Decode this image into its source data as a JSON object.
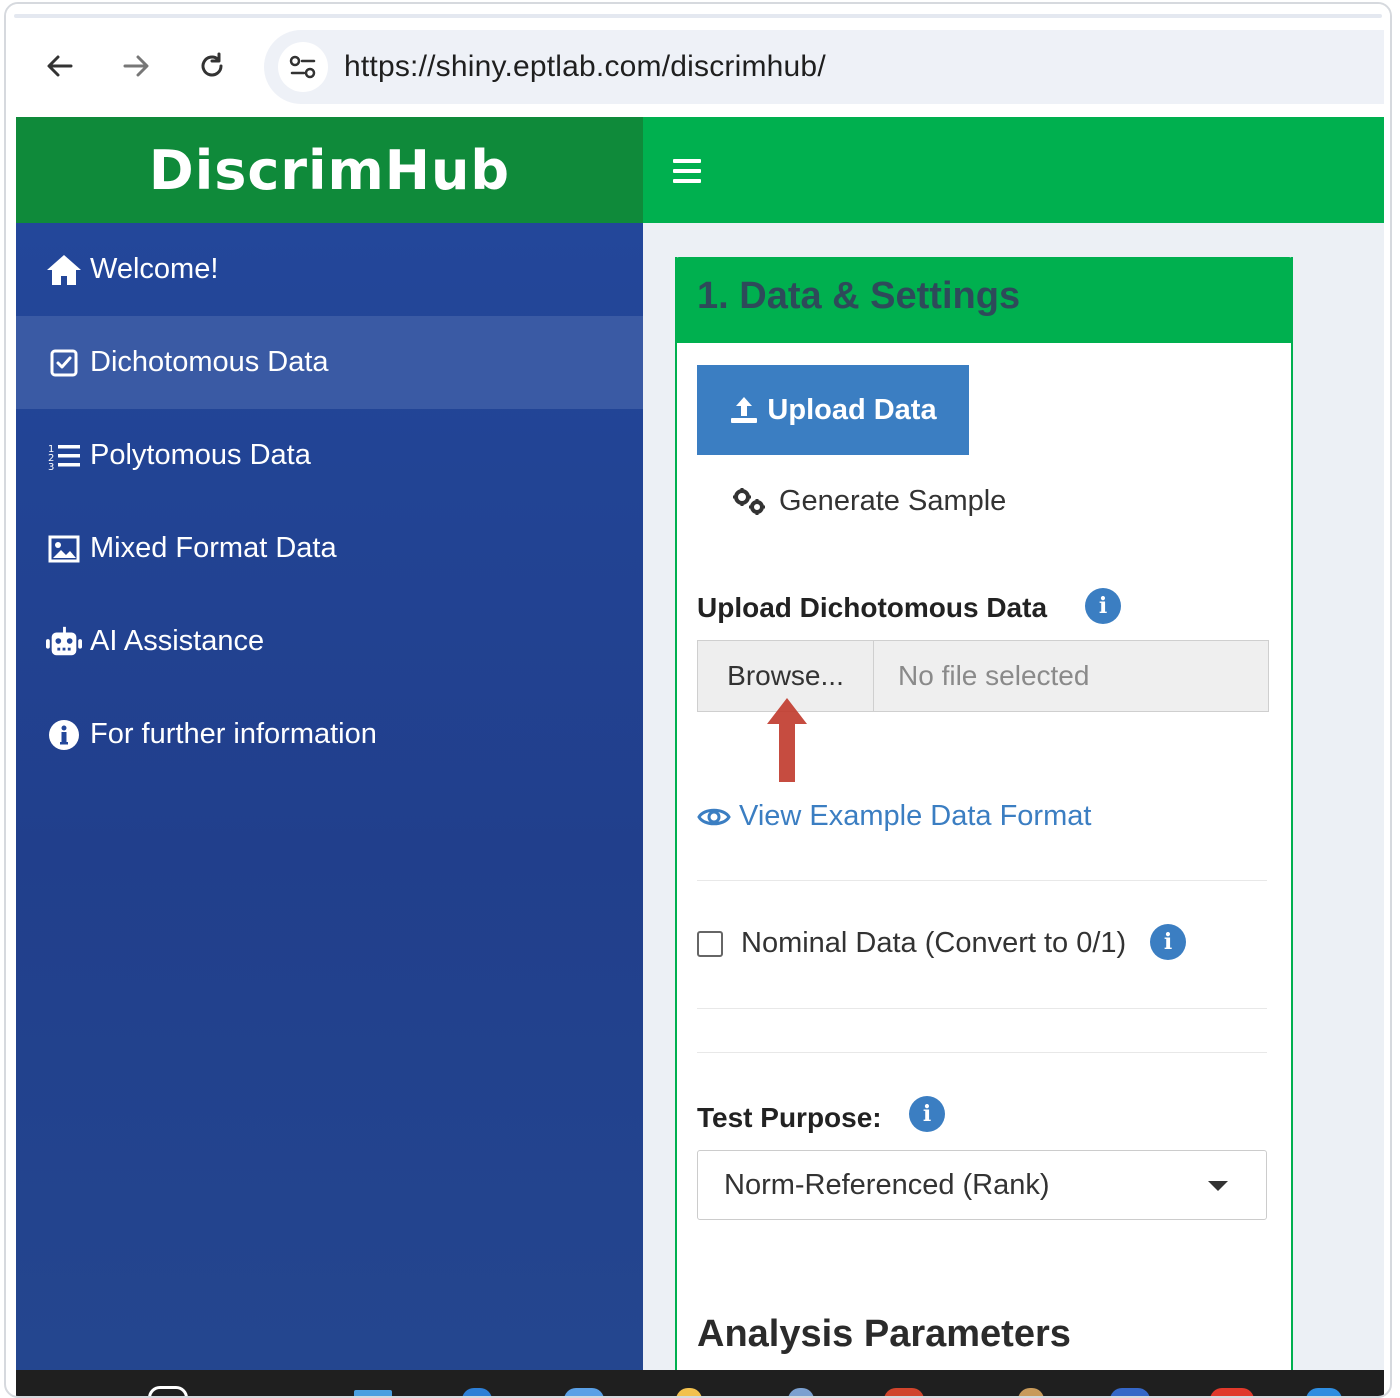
{
  "browser": {
    "url": "https://shiny.eptlab.com/discrimhub/"
  },
  "app": {
    "title": "DiscrimHub"
  },
  "sidebar": {
    "items": [
      {
        "label": "Welcome!",
        "icon": "home-icon"
      },
      {
        "label": "Dichotomous Data",
        "icon": "check-square-icon",
        "active": true
      },
      {
        "label": "Polytomous Data",
        "icon": "list-ol-icon"
      },
      {
        "label": "Mixed Format Data",
        "icon": "image-icon"
      },
      {
        "label": "AI Assistance",
        "icon": "robot-icon"
      },
      {
        "label": "For further information",
        "icon": "info-circle-icon"
      }
    ]
  },
  "panel": {
    "title": "1. Data & Settings",
    "tabs": {
      "upload": "Upload Data",
      "generate": "Generate Sample"
    },
    "upload_label": "Upload Dichotomous Data",
    "browse_label": "Browse...",
    "file_status": "No file selected",
    "view_example": "View Example Data Format",
    "nominal_label": "Nominal Data (Convert to 0/1)",
    "nominal_checked": false,
    "test_purpose_label": "Test Purpose:",
    "test_purpose_value": "Norm-Referenced (Rank)",
    "analysis_heading": "Analysis Parameters"
  },
  "colors": {
    "header_green": "#00b04f",
    "logo_green": "#0f8a3a",
    "sidebar_blue": "#23479a",
    "primary_blue": "#3b7ec2",
    "annotation_red": "#c0392b"
  }
}
